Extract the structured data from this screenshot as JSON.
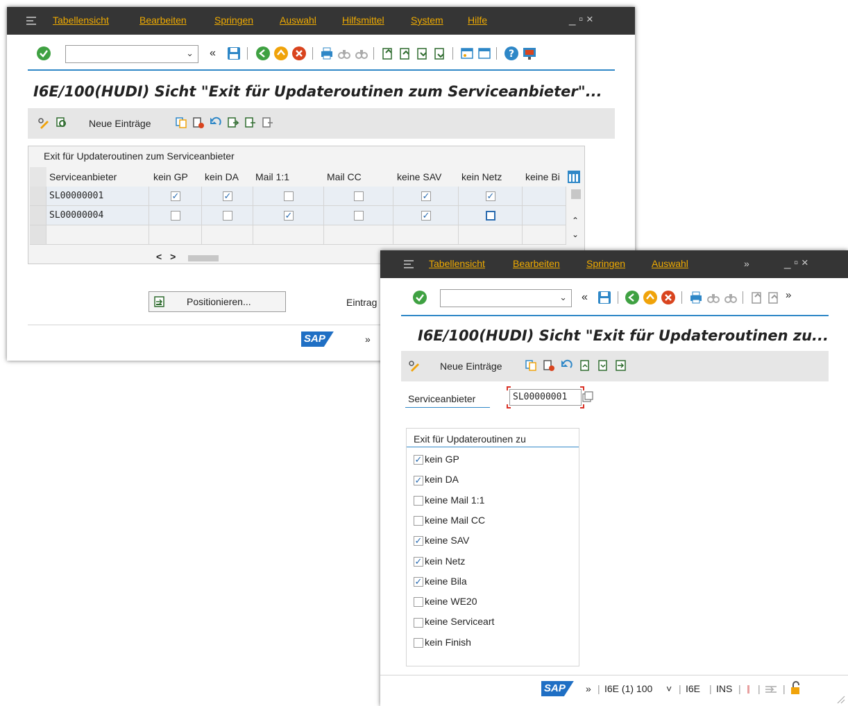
{
  "back_window": {
    "menu": [
      "Tabellensicht",
      "Bearbeiten",
      "Springen",
      "Auswahl",
      "Hilfsmittel",
      "System",
      "Hilfe"
    ],
    "window_controls": "_ ▫ ×",
    "nav_symbol": "«",
    "title": "I6E/100(HUDI) Sicht \"Exit für Updateroutinen zum Serviceanbieter\"...",
    "apptoolbar": {
      "new_entries": "Neue Einträge"
    },
    "table": {
      "title": "Exit für Updateroutinen zum Serviceanbieter",
      "columns": [
        "Serviceanbieter",
        "kein GP",
        "kein DA",
        "Mail 1:1",
        "Mail CC",
        "keine SAV",
        "kein Netz",
        "keine Bi"
      ],
      "rows": [
        {
          "provider": "SL00000001",
          "flags": [
            true,
            true,
            false,
            false,
            true,
            true
          ]
        },
        {
          "provider": "SL00000004",
          "flags": [
            false,
            false,
            true,
            false,
            true,
            false
          ]
        }
      ],
      "hscroll": "<  >"
    },
    "position_button": "Positionieren...",
    "entries_label": "Eintrag",
    "status_more": "»"
  },
  "front_window": {
    "menu": [
      "Tabellensicht",
      "Bearbeiten",
      "Springen",
      "Auswahl"
    ],
    "menu_more": "»",
    "window_controls": "_ ▫ ×",
    "nav_symbol": "«",
    "toolbar_more": "»",
    "title": "I6E/100(HUDI) Sicht \"Exit für Updateroutinen zu...",
    "apptoolbar": {
      "new_entries": "Neue Einträge"
    },
    "provider_label": "Serviceanbieter",
    "provider_value": "SL00000001",
    "group_title": "Exit für Updateroutinen zu",
    "options": [
      {
        "label": "kein GP",
        "checked": true
      },
      {
        "label": "kein DA",
        "checked": true
      },
      {
        "label": "keine Mail 1:1",
        "checked": false
      },
      {
        "label": "keine Mail CC",
        "checked": false
      },
      {
        "label": "keine SAV",
        "checked": true
      },
      {
        "label": "kein Netz",
        "checked": true
      },
      {
        "label": "keine Bila",
        "checked": true
      },
      {
        "label": "keine WE20",
        "checked": false
      },
      {
        "label": "keine Serviceart",
        "checked": false
      },
      {
        "label": "kein Finish",
        "checked": false
      }
    ],
    "status": {
      "more": "»",
      "system": "I6E (1) 100",
      "system_dropdown": "˅",
      "client": "I6E",
      "mode": "INS"
    }
  },
  "colors": {
    "titlebar": "#353535",
    "menu_text": "#f0ab00",
    "accent_line": "#2e87c7",
    "sap_blue": "#1f6fc4"
  }
}
